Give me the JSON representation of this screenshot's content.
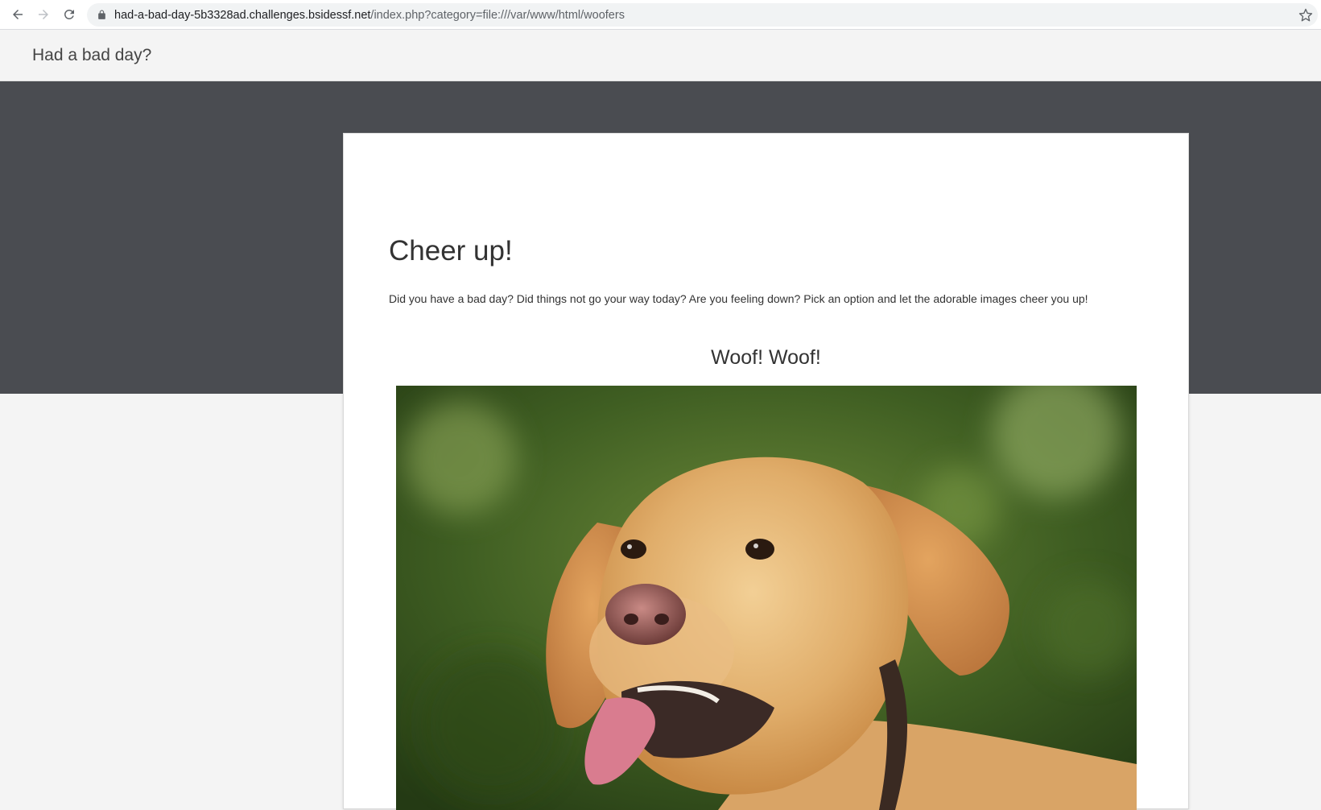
{
  "browser": {
    "url_host": "had-a-bad-day-5b3328ad.challenges.bsidessf.net",
    "url_path": "/index.php?category=file:///var/www/html/woofers",
    "icons": [
      "back-icon",
      "forward-icon",
      "reload-icon",
      "lock-icon",
      "bookmark-star-icon"
    ]
  },
  "navbar": {
    "brand": "Had a bad day?"
  },
  "content": {
    "title": "Cheer up!",
    "lead": "Did you have a bad day? Did things not go your way today? Are you feeling down? Pick an option and let the adorable images cheer you up!",
    "section_title": "Woof! Woof!",
    "image_subject": "golden-labrador-dog-photo"
  },
  "colors": {
    "hero_band": "#4a4c51",
    "page_bg": "#f4f4f4",
    "card_bg": "#ffffff"
  }
}
